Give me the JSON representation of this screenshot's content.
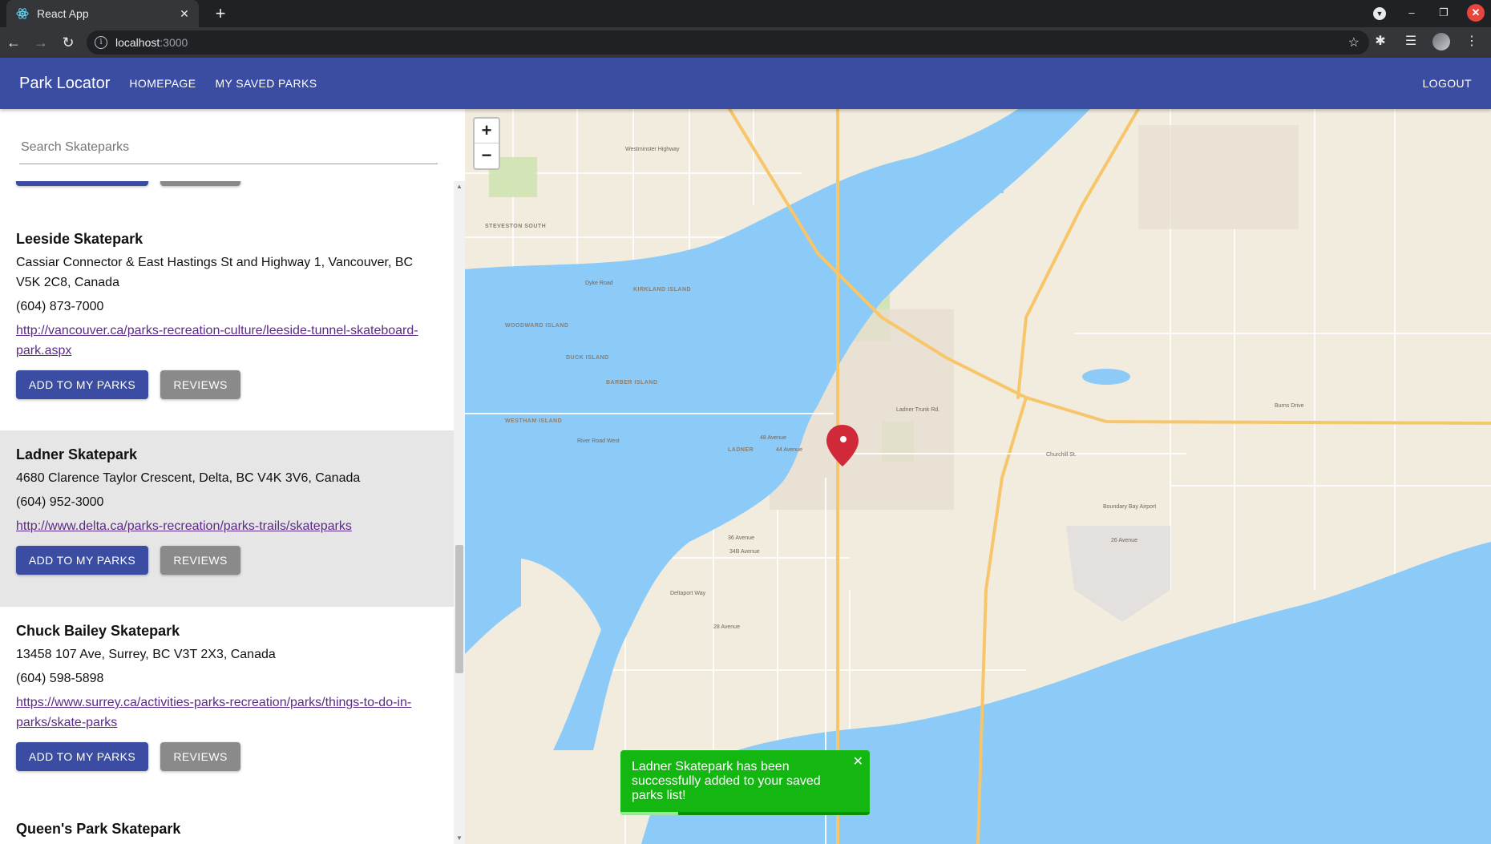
{
  "browser": {
    "tab_title": "React App",
    "url_host": "localhost",
    "url_port": ":3000"
  },
  "appbar": {
    "brand": "Park Locator",
    "nav": [
      "HOMEPAGE",
      "MY SAVED PARKS"
    ],
    "logout": "LOGOUT"
  },
  "search": {
    "placeholder": "Search Skateparks",
    "value": ""
  },
  "parks": [
    {
      "name": "Leeside Skatepark",
      "address": "Cassiar Connector & East Hastings St and Highway 1, Vancouver, BC V5K 2C8, Canada",
      "phone": "(604) 873-7000",
      "url": "http://vancouver.ca/parks-recreation-culture/leeside-tunnel-skateboard-park.aspx",
      "add_label": "ADD TO MY PARKS",
      "reviews_label": "REVIEWS"
    },
    {
      "name": "Ladner Skatepark",
      "address": "4680 Clarence Taylor Crescent, Delta, BC V4K 3V6, Canada",
      "phone": "(604) 952-3000",
      "url": "http://www.delta.ca/parks-recreation/parks-trails/skateparks",
      "add_label": "ADD TO MY PARKS",
      "reviews_label": "REVIEWS"
    },
    {
      "name": "Chuck Bailey Skatepark",
      "address": "13458 107 Ave, Surrey, BC V3T 2X3, Canada",
      "phone": "(604) 598-5898",
      "url": "https://www.surrey.ca/activities-parks-recreation/parks/things-to-do-in-parks/skate-parks",
      "add_label": "ADD TO MY PARKS",
      "reviews_label": "REVIEWS"
    },
    {
      "name": "Queen's Park Skatepark"
    }
  ],
  "map": {
    "zoom_in": "+",
    "zoom_out": "−",
    "labels": {
      "island_westham": "WESTHAM ISLAND",
      "island_barber": "BARBER ISLAND",
      "island_duck": "DUCK ISLAND",
      "island_woodward": "WOODWARD ISLAND",
      "island_kirkland": "KIRKLAND ISLAND",
      "ladner": "LADNER",
      "delta_partial": "De",
      "boundary_bay": "Boundary Bay Airport",
      "ladner_trunk": "Ladner Trunk Rd.",
      "churchill": "Churchill St.",
      "ave_48": "48 Avenue",
      "ave_44": "44 Avenue",
      "ave_36": "36 Avenue",
      "ave_34b": "34B Avenue",
      "deltaport": "Deltaport Way",
      "ave_28": "28 Avenue",
      "river_rd": "River Road West",
      "dyke_rd": "Dyke Road",
      "westminster_hwy": "Westminster Highway",
      "steveston": "STEVESTON SOUTH",
      "ave_26": "26 Avenue",
      "burns_dr": "Burns Drive"
    }
  },
  "snackbar": {
    "message": "Ladner Skatepark has been successfully added to your saved parks list!",
    "close": "✕",
    "progress": 0.23
  },
  "colors": {
    "primary": "#3a4da3",
    "snackbar": "#14b712",
    "water": "#8ccaf7",
    "marker": "#d0293a"
  }
}
